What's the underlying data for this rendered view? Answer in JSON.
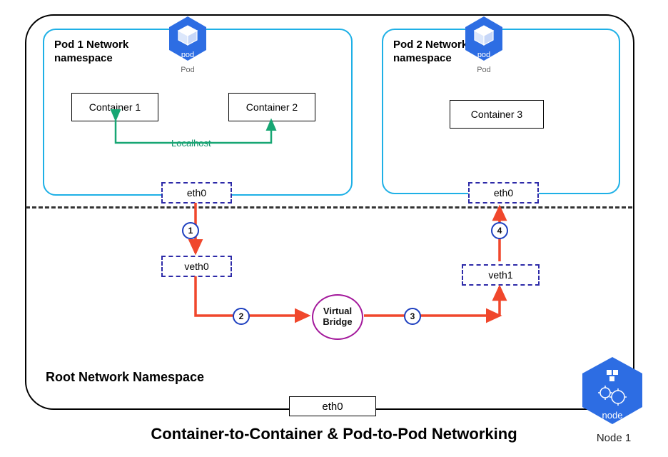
{
  "title": "Container-to-Container & Pod-to-Pod Networking",
  "node_label": "Node 1",
  "root_ns_label": "Root Network Namespace",
  "localhost_label": "Localhost",
  "vbridge_label": "Virtual Bridge",
  "eth0_label": "eth0",
  "pod1": {
    "title_line1": "Pod 1 Network",
    "title_line2": "namespace",
    "icon_sub": "Pod",
    "icon_text": "pod",
    "container1": "Container 1",
    "container2": "Container 2",
    "eth": "eth0"
  },
  "pod2": {
    "title_line1": "Pod 2 Network",
    "title_line2": "namespace",
    "icon_sub": "Pod",
    "icon_text": "pod",
    "container3": "Container 3",
    "eth": "eth0"
  },
  "veth0_label": "veth0",
  "veth1_label": "veth1",
  "steps": {
    "s1": "1",
    "s2": "2",
    "s3": "3",
    "s4": "4"
  },
  "node_icon_text": "node"
}
